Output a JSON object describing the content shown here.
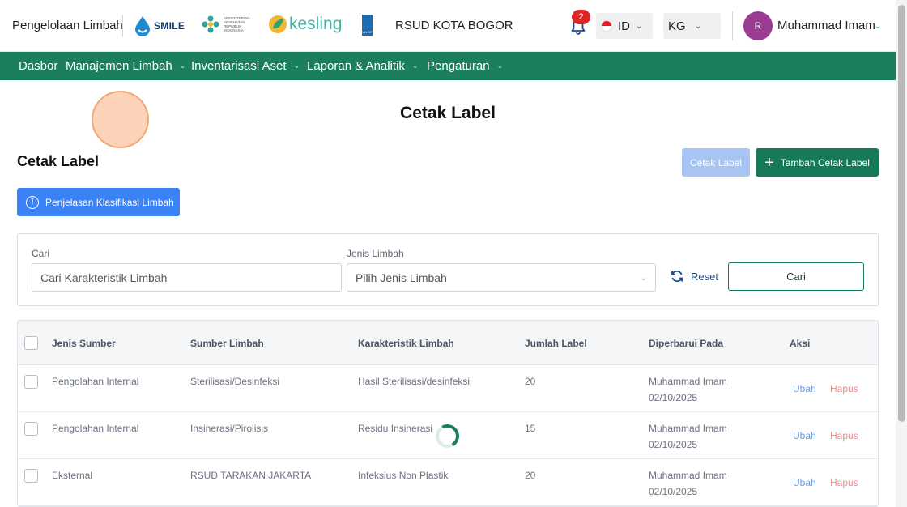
{
  "header": {
    "app_name": "Pengelolaan Limbah",
    "logos": {
      "smile": "SMILE",
      "kemenkes": "KEMENTERIAN KESEHATAN REPUBLIK INDONESIA",
      "kesling": "kesling",
      "undp": "UN DP"
    },
    "hospital": "RSUD KOTA BOGOR",
    "notifications_count": "2",
    "language": "ID",
    "unit": "KG",
    "user": {
      "initial": "R",
      "name": "Muhammad Imam"
    }
  },
  "nav": {
    "items": [
      {
        "label": "Dasbor",
        "has_dropdown": false
      },
      {
        "label": "Manajemen Limbah",
        "has_dropdown": true
      },
      {
        "label": "Inventarisasi Aset",
        "has_dropdown": true
      },
      {
        "label": "Laporan & Analitik",
        "has_dropdown": true
      },
      {
        "label": "Pengaturan",
        "has_dropdown": true
      }
    ]
  },
  "page": {
    "title": "Cetak Label",
    "section_title": "Cetak Label",
    "print_button": "Cetak Label",
    "add_button": "Tambah Cetak Label",
    "info_button": "Penjelasan Klasifikasi Limbah"
  },
  "filter": {
    "search_label": "Cari",
    "search_placeholder": "Cari Karakteristik Limbah",
    "type_label": "Jenis Limbah",
    "type_placeholder": "Pilih Jenis Limbah",
    "reset_label": "Reset",
    "search_button": "Cari"
  },
  "table": {
    "columns": [
      "Jenis Sumber",
      "Sumber Limbah",
      "Karakteristik Limbah",
      "Jumlah Label",
      "Diperbarui Pada",
      "Aksi"
    ],
    "rows": [
      {
        "jenis_sumber": "Pengolahan Internal",
        "sumber_limbah": "Sterilisasi/Desinfeksi",
        "karakteristik": "Hasil Sterilisasi/desinfeksi",
        "jumlah": "20",
        "updated_by": "Muhammad Imam",
        "updated_at": "02/10/2025",
        "edit": "Ubah",
        "delete": "Hapus"
      },
      {
        "jenis_sumber": "Pengolahan Internal",
        "sumber_limbah": "Insinerasi/Pirolisis",
        "karakteristik": "Residu Insinerasi",
        "jumlah": "15",
        "updated_by": "Muhammad Imam",
        "updated_at": "02/10/2025",
        "edit": "Ubah",
        "delete": "Hapus"
      },
      {
        "jenis_sumber": "Eksternal",
        "sumber_limbah": "RSUD TARAKAN JAKARTA",
        "karakteristik": "Infeksius Non Plastik",
        "jumlah": "20",
        "updated_by": "Muhammad Imam",
        "updated_at": "02/10/2025",
        "edit": "Ubah",
        "delete": "Hapus"
      }
    ]
  },
  "colors": {
    "primary_green": "#1a7f5a",
    "info_blue": "#3b82f6",
    "danger": "#ee8c8c"
  }
}
